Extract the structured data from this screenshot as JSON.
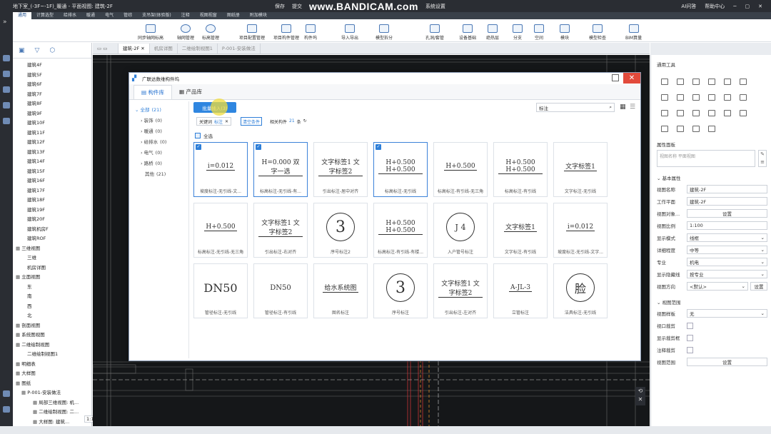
{
  "window": {
    "title": "地下室_(-3F~-1F)_暖通 - 平面视图: 建筑-2F",
    "save": "保存",
    "submit": "提交",
    "watermark": "www.BANDICAM.com",
    "system_settings": "系统设置",
    "ai_assistant": "AI问答",
    "help_center": "帮助中心"
  },
  "menu_tabs": [
    {
      "label": "通用",
      "active": true
    },
    {
      "label": "计算选型"
    },
    {
      "label": "给排水"
    },
    {
      "label": "暖通"
    },
    {
      "label": "电气"
    },
    {
      "label": "管综"
    },
    {
      "label": "支吊架(体验版)"
    },
    {
      "label": "注释"
    },
    {
      "label": "视图视窗"
    },
    {
      "label": "图纸册"
    },
    {
      "label": "附加模块"
    }
  ],
  "ribbon": [
    "同步轴网标高",
    "轴网管理",
    "标高管理",
    "项目配置管理",
    "项目构件管理",
    "构件坞",
    "导入导出",
    "模型拆分",
    "孔洞/套管",
    "设备基础",
    "绝热层",
    "分支",
    "空间",
    "模块",
    "模型检查",
    "BIM算量"
  ],
  "tree": {
    "floors": [
      "建筑4F",
      "建筑5F",
      "建筑6F",
      "建筑7F",
      "建筑8F",
      "建筑9F",
      "建筑10F",
      "建筑11F",
      "建筑12F",
      "建筑13F",
      "建筑14F",
      "建筑15F",
      "建筑16F",
      "建筑17F",
      "建筑18F",
      "建筑19F",
      "建筑20F",
      "建筑机房F",
      "建筑ROF"
    ],
    "three_d_view": "三维视图",
    "three_d_items": [
      "三维",
      "机房详图"
    ],
    "elevation": "立面视图",
    "elevation_items": [
      "东",
      "南",
      "西",
      "北"
    ],
    "section": "剖面视图",
    "system_view": "系统图视图",
    "two_d_view": "二维绘制视图",
    "two_d_item": "二维绘制视图1",
    "schedule": "明细表",
    "detail": "大样图",
    "drawings": "图纸",
    "drawing_item": "P-001-安装做法",
    "drawing_subs": [
      "局部三维视图: 机...",
      "二维绘制视图: 二...",
      "大样图: 建筑..."
    ],
    "zoom": "1:100"
  },
  "doc_tabs": [
    {
      "label": "建筑-2F",
      "active": true
    },
    {
      "label": "机房详图"
    },
    {
      "label": "二维绘制视图1"
    },
    {
      "label": "P-001-安装做法"
    }
  ],
  "dialog": {
    "title": "广联达数维构件坞",
    "tabs": [
      {
        "label": "构件库",
        "active": true
      },
      {
        "label": "产品库"
      }
    ],
    "categories": [
      {
        "label": "全部",
        "count": "(21)"
      },
      {
        "label": "装饰",
        "count": "(0)"
      },
      {
        "label": "暖通",
        "count": "(0)"
      },
      {
        "label": "给排水",
        "count": "(0)"
      },
      {
        "label": "电气",
        "count": "(0)"
      },
      {
        "label": "路桥",
        "count": "(0)"
      },
      {
        "label": "其他",
        "count": "(21)"
      }
    ],
    "batch_button": "批量插入(3)",
    "search_value": "标注",
    "keyword_label": "关键词",
    "keyword_value": "标注",
    "clear_filters": "清空条件",
    "related_label": "相关构件",
    "related_count": "21",
    "related_unit": "条",
    "select_all": "全选",
    "cards": [
      {
        "img": "i=0.012",
        "label": "坡度标注-无引线-文...",
        "selected": true
      },
      {
        "img": "H=0.000 双字一选",
        "label": "标高标注-无引线-有...",
        "selected": true
      },
      {
        "img": "文字标签1 文字标签2",
        "label": "引出标注-居中对齐",
        "selected": false
      },
      {
        "img": "H+0.500 H+0.500",
        "label": "标高标注-无引线",
        "selected": true
      },
      {
        "img": "H+0.500",
        "label": "标高标注-有引线-无三角",
        "selected": false
      },
      {
        "img": "H+0.500 H+0.500",
        "label": "标高标注-有引线",
        "selected": false
      },
      {
        "img": "文字标签1",
        "label": "文字标注-无引线",
        "selected": false
      },
      {
        "img": "H+0.500",
        "label": "标高标注-无引线-无三角",
        "selected": false
      },
      {
        "img": "文字标签1 文字标签2",
        "label": "引出标注-右对齐",
        "selected": false
      },
      {
        "img": "3",
        "label": "序号标注2",
        "selected": false
      },
      {
        "img": "H+0.500 H+0.500",
        "label": "标高标注-有引线-有楼...",
        "selected": false
      },
      {
        "img": "J 4",
        "label": "入户管号标注",
        "selected": false
      },
      {
        "img": "文字标签1",
        "label": "文字标注-有引线",
        "selected": false
      },
      {
        "img": "i=0.012",
        "label": "坡度标注-无引线-文字...",
        "selected": false
      },
      {
        "img": "DN50",
        "label": "管径标注-无引线",
        "selected": false
      },
      {
        "img": "DN50",
        "label": "管径标注-有引线",
        "selected": false
      },
      {
        "img": "给水系统图",
        "label": "图名标注",
        "selected": false
      },
      {
        "img": "3",
        "label": "序号标注",
        "selected": false
      },
      {
        "img": "文字标签1 文字标签2",
        "label": "引出标注-左对齐",
        "selected": false
      },
      {
        "img": "A-JL-3",
        "label": "立管标注",
        "selected": false
      },
      {
        "img": "脸",
        "label": "洁具标注-无引线",
        "selected": false
      }
    ]
  },
  "props": {
    "general_tools": "通用工具",
    "type_section": "属性面板",
    "type_placeholder": "视图名称 平面视图",
    "basic_attrs": "基本属性",
    "rows": [
      {
        "k": "视图名称",
        "v": "建筑-2F"
      },
      {
        "k": "工作平面",
        "v": "建筑-2F"
      },
      {
        "k": "视图对象...",
        "v": "设置"
      },
      {
        "k": "视图比例",
        "v": "1:100"
      },
      {
        "k": "显示模式",
        "v": "线框"
      },
      {
        "k": "详细程度",
        "v": "中等"
      },
      {
        "k": "专业",
        "v": "机电"
      },
      {
        "k": "显示隐藏线",
        "v": "按专业"
      },
      {
        "k": "视图方向",
        "v": "<默认>"
      }
    ],
    "set_btn": "设置",
    "range_section": "视图范围",
    "range_rows": [
      {
        "k": "视图样板",
        "v": "无"
      },
      {
        "k": "视口裁剪",
        "v": ""
      },
      {
        "k": "显示裁剪框",
        "v": ""
      },
      {
        "k": "注释裁剪",
        "v": ""
      },
      {
        "k": "视图范围",
        "v": "设置"
      }
    ]
  }
}
